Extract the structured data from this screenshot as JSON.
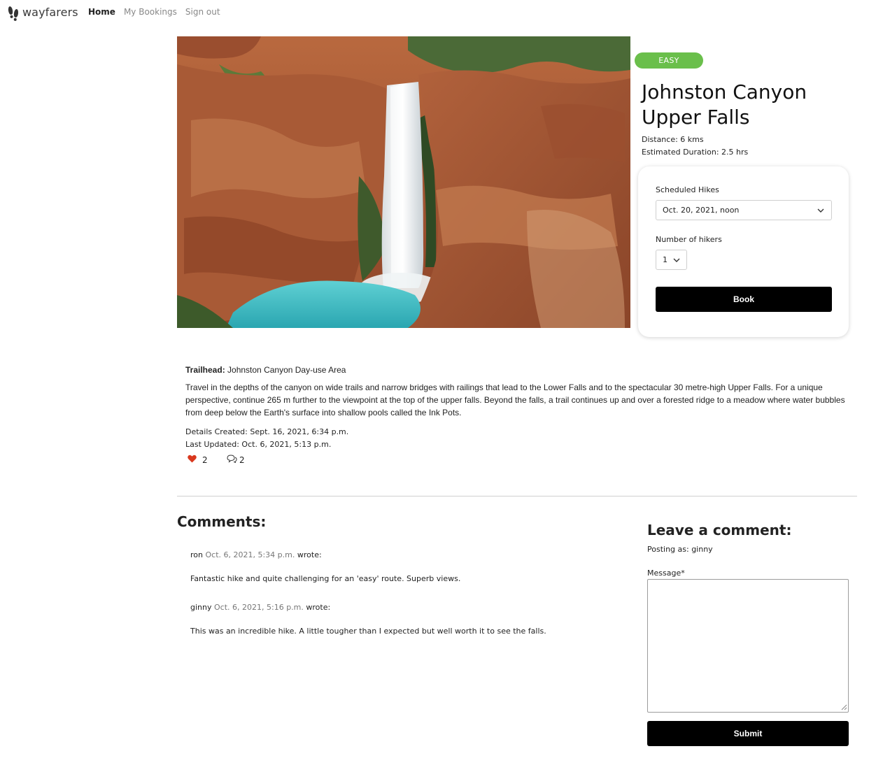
{
  "nav": {
    "brand": "wayfarers",
    "links": [
      "Home",
      "My Bookings",
      "Sign out"
    ]
  },
  "hike": {
    "difficulty": "EASY",
    "title": "Johnston Canyon Upper Falls",
    "distance": "Distance: 6 kms",
    "duration": "Estimated Duration: 2.5 hrs",
    "image_alt": "waterfall"
  },
  "booking": {
    "scheduled_label": "Scheduled Hikes",
    "scheduled_value": "Oct. 20, 2021, noon",
    "hikers_label": "Number of hikers",
    "hikers_value": "1",
    "book_label": "Book"
  },
  "details": {
    "trailhead_label": "Trailhead:",
    "trailhead_value": "Johnston Canyon Day-use Area",
    "description": "Travel in the depths of the canyon on wide trails and narrow bridges with railings that lead to the Lower Falls and to the spectacular 30 metre-high Upper Falls. For a unique perspective, continue 265 m further to the viewpoint at the top of the upper falls. Beyond the falls, a trail continues up and over a forested ridge to a meadow where water bubbles from deep below the Earth's surface into shallow pools called the Ink Pots.",
    "created": "Details Created: Sept. 16, 2021, 6:34 p.m.",
    "updated": "Last Updated: Oct. 6, 2021, 5:13 p.m.",
    "likes": "2",
    "comment_count": "2"
  },
  "comments": {
    "title": "Comments:",
    "items": [
      {
        "author": "ron",
        "time": "Oct. 6, 2021, 5:34 p.m.",
        "wrote": "wrote:",
        "body": "Fantastic hike and quite challenging for an 'easy' route. Superb views."
      },
      {
        "author": "ginny",
        "time": "Oct. 6, 2021, 5:16 p.m.",
        "wrote": "wrote:",
        "body": "This was an incredible hike. A little tougher than I expected but well worth it to see the falls."
      }
    ]
  },
  "comment_form": {
    "title": "Leave a comment:",
    "posting_as": "Posting as: ginny",
    "message_label": "Message*",
    "message_value": "",
    "submit_label": "Submit"
  },
  "colors": {
    "badge": "#6abf4b",
    "button": "#000000",
    "heart": "#d9381e"
  },
  "icons": [
    "footprints-icon",
    "chevron-down-icon",
    "heart-icon",
    "comment-bubbles-icon",
    "resize-grip-icon"
  ]
}
